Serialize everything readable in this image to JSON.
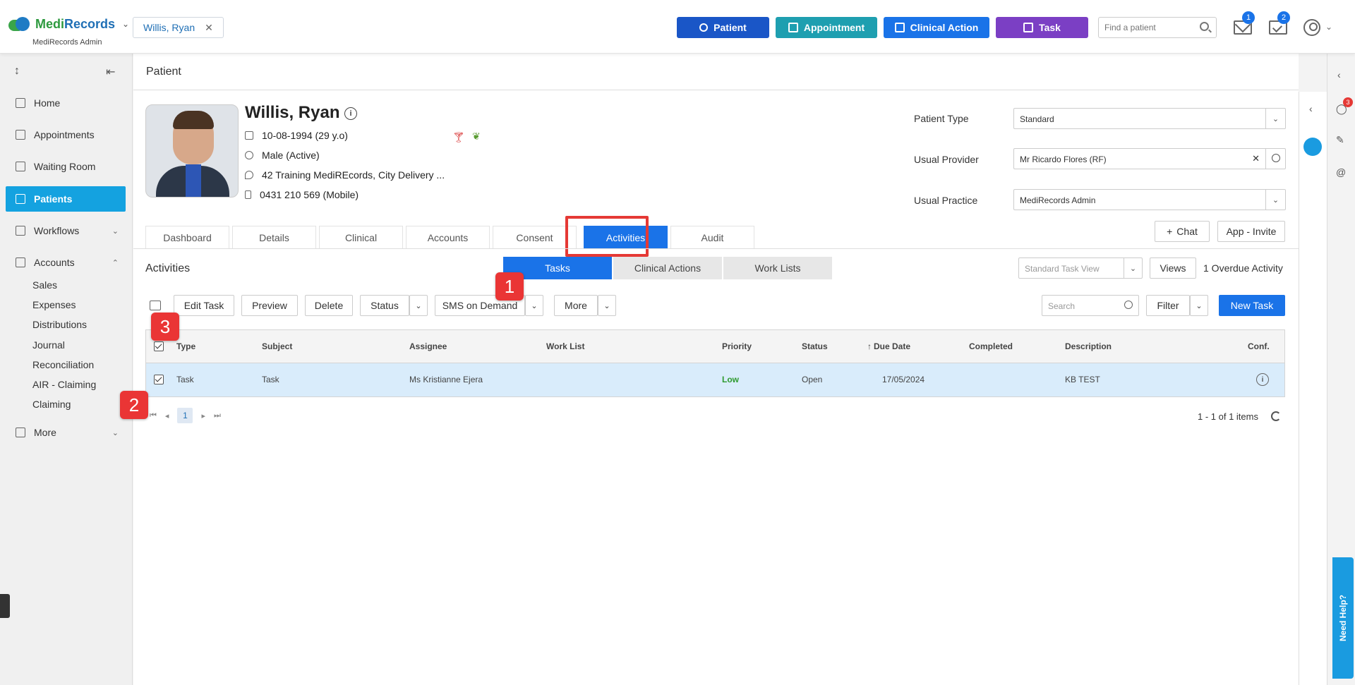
{
  "header": {
    "brand_medi": "Medi",
    "brand_records": "Records",
    "brand_sub": "MediRecords Admin",
    "open_patient": "Willis, Ryan",
    "buttons": {
      "patient": "Patient",
      "appointment": "Appointment",
      "clinical_action": "Clinical Action",
      "task": "Task"
    },
    "search_placeholder": "Find a patient",
    "mail_count": "1",
    "tasks_count": "2"
  },
  "sidebar": {
    "items": [
      {
        "label": "Home"
      },
      {
        "label": "Appointments"
      },
      {
        "label": "Waiting Room"
      },
      {
        "label": "Patients"
      },
      {
        "label": "Workflows"
      },
      {
        "label": "Accounts"
      },
      {
        "label": "More"
      }
    ],
    "accounts_sub": [
      "Sales",
      "Expenses",
      "Distributions",
      "Journal",
      "Reconciliation",
      "AIR - Claiming",
      "Claiming"
    ]
  },
  "page": {
    "title": "Patient"
  },
  "patient": {
    "name": "Willis, Ryan",
    "dob": "10-08-1994 (29 y.o)",
    "gender": "Male (Active)",
    "address": "42 Training MediREcords, City Delivery ...",
    "phone": "0431 210 569 (Mobile)",
    "fields": {
      "type_label": "Patient Type",
      "type_value": "Standard",
      "provider_label": "Usual Provider",
      "provider_value": "Mr Ricardo Flores (RF)",
      "practice_label": "Usual Practice",
      "practice_value": "MediRecords Admin"
    }
  },
  "tabs": [
    "Dashboard",
    "Details",
    "Clinical",
    "Accounts",
    "Consent",
    "Activities",
    "Audit"
  ],
  "actions": {
    "chat": "Chat",
    "app_invite": "App - Invite"
  },
  "activities": {
    "title": "Activities",
    "segments": [
      "Tasks",
      "Clinical Actions",
      "Work Lists"
    ],
    "view_placeholder": "Standard Task View",
    "views_label": "Views",
    "overdue": "1 Overdue Activity",
    "toolbar": {
      "edit": "Edit Task",
      "preview": "Preview",
      "delete": "Delete",
      "status": "Status",
      "sms": "SMS on Demand",
      "more": "More",
      "search_placeholder": "Search",
      "filter": "Filter",
      "new_task": "New Task"
    },
    "columns": [
      "Type",
      "Subject",
      "Assignee",
      "Work List",
      "Priority",
      "Status",
      "Due Date",
      "Completed",
      "Description",
      "Conf."
    ],
    "rows": [
      {
        "type": "Task",
        "subject": "Task",
        "assignee": "Ms Kristianne Ejera",
        "work_list": "",
        "priority": "Low",
        "status": "Open",
        "due": "17/05/2024",
        "completed": "",
        "description": "KB TEST"
      }
    ],
    "pager": {
      "page": "1",
      "info": "1 - 1 of 1 items"
    }
  },
  "right_rail": {
    "notifications_count": "3",
    "need_help": "Need Help?"
  },
  "callouts": [
    "1",
    "2",
    "3"
  ],
  "colors": {
    "primary": "#1a73e8",
    "appointment": "#1e9fb0",
    "task": "#7b3fc4",
    "patient": "#1a56c7",
    "sidebar_active": "#14a2e0",
    "callout": "#ea3535",
    "selected_row": "#d9ecfb"
  }
}
